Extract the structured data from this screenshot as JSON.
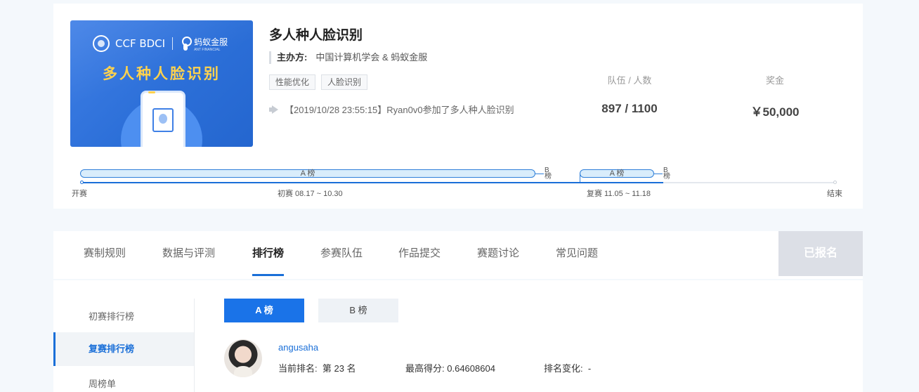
{
  "competition": {
    "title": "多人种人脸识别",
    "host_label": "主办方:",
    "host_value": "中国计算机学会 & 蚂蚁金服",
    "tags": [
      "性能优化",
      "人脸识别"
    ],
    "news": "【2019/10/28 23:55:15】Ryan0v0参加了多人种人脸识别",
    "banner": {
      "logo_left": "CCF BDCI",
      "logo_right": "蚂蚁金服",
      "logo_right_sub": "ANT FINANCIAL",
      "title": "多人种人脸识别"
    }
  },
  "stats": {
    "teams_label": "队伍 / 人数",
    "teams_value": "897 / 1100",
    "prize_label": "奖金",
    "prize_value": "￥50,000"
  },
  "timeline": {
    "start_label": "开赛",
    "prelim_label": "初赛 08.17 ~ 10.30",
    "final_label": "复赛 11.05 ~ 11.18",
    "end_label": "结束",
    "prelim_a": "A 榜",
    "prelim_b": "B 榜",
    "final_a": "A 榜",
    "final_b": "B 榜"
  },
  "tabs": [
    "赛制规则",
    "数据与评测",
    "排行榜",
    "参赛队伍",
    "作品提交",
    "赛题讨论",
    "常见问题"
  ],
  "active_tab": "排行榜",
  "registered_label": "已报名",
  "sidebar": [
    "初赛排行榜",
    "复赛排行榜",
    "周榜单"
  ],
  "active_sidebar": "复赛排行榜",
  "boards": {
    "a": "A 榜",
    "b": "B 榜"
  },
  "leader": {
    "username": "angusaha",
    "rank_label": "当前排名:",
    "rank_value": "第 23 名",
    "score_label": "最高得分:",
    "score_value": "0.64608604",
    "change_label": "排名变化:",
    "change_value": "-"
  },
  "colors": {
    "accent": "#1a6fd8",
    "registered_bg": "#dcdfe6",
    "page_bg": "#f4f8fc"
  }
}
